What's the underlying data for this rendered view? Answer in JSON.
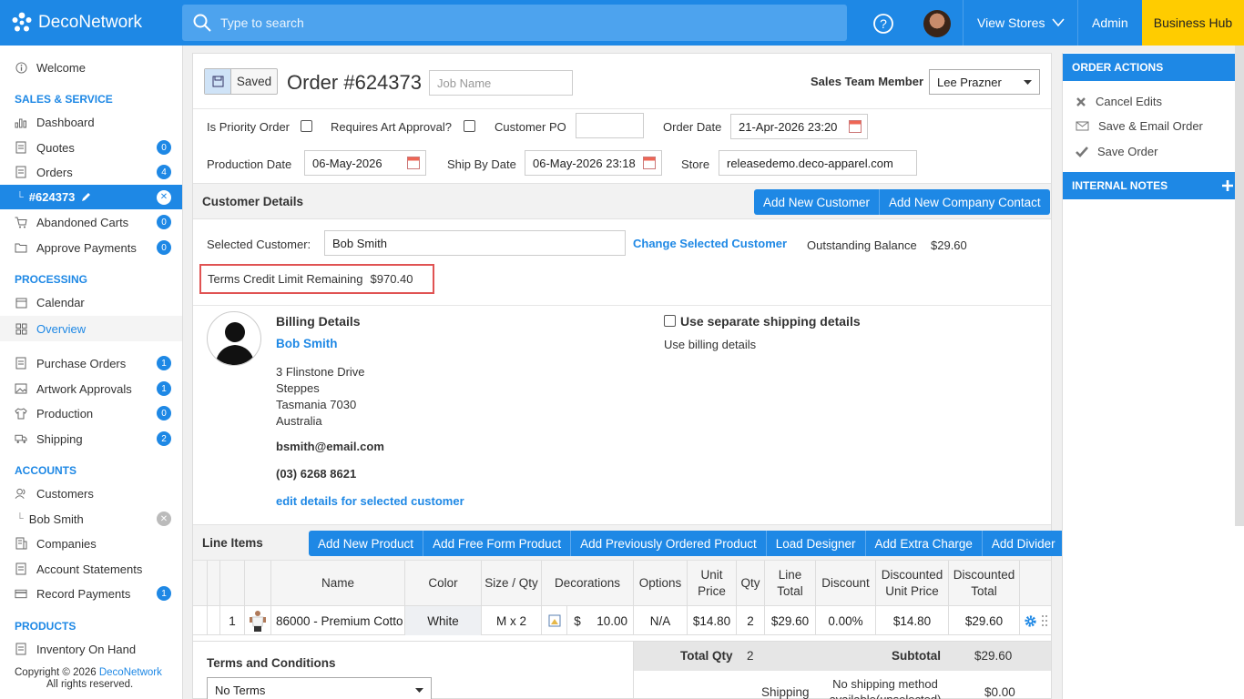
{
  "topbar": {
    "logo": "DecoNetwork",
    "search_placeholder": "Type to search",
    "view_stores": "View Stores",
    "admin": "Admin",
    "business_hub": "Business Hub"
  },
  "sidebar": {
    "welcome": "Welcome",
    "sales_head": "SALES & SERVICE",
    "dashboard": "Dashboard",
    "quotes": "Quotes",
    "quotes_count": "0",
    "orders": "Orders",
    "orders_count": "4",
    "order_sub": "#624373",
    "abandoned": "Abandoned Carts",
    "abandoned_count": "0",
    "approve": "Approve Payments",
    "approve_count": "0",
    "processing_head": "PROCESSING",
    "calendar": "Calendar",
    "overview": "Overview",
    "purchase": "Purchase Orders",
    "purchase_count": "1",
    "artwork": "Artwork Approvals",
    "artwork_count": "1",
    "production": "Production",
    "production_count": "0",
    "shipping": "Shipping",
    "shipping_count": "2",
    "accounts_head": "ACCOUNTS",
    "customers": "Customers",
    "customer_sub": "Bob Smith",
    "companies": "Companies",
    "statements": "Account Statements",
    "record": "Record Payments",
    "record_count": "1",
    "products_head": "PRODUCTS",
    "inventory": "Inventory On Hand",
    "copyright_pre": "Copyright © 2026 ",
    "copyright_link": "DecoNetwork",
    "copyright_post": "All rights reserved."
  },
  "order": {
    "saved": "Saved",
    "title": "Order #624373",
    "job_placeholder": "Job Name",
    "sales_label": "Sales Team Member",
    "sales_value": "Lee Prazner",
    "priority_label": "Is Priority Order",
    "art_label": "Requires Art Approval?",
    "po_label": "Customer PO",
    "order_date_label": "Order Date",
    "order_date": "21-Apr-2026 23:20",
    "prod_date_label": "Production Date",
    "prod_date": "06-May-2026",
    "ship_label": "Ship By Date",
    "ship_date": "06-May-2026 23:18",
    "store_label": "Store",
    "store": "releasedemo.deco-apparel.com"
  },
  "customer": {
    "section": "Customer Details",
    "add_customer": "Add New Customer",
    "add_contact": "Add New Company Contact",
    "selected_label": "Selected Customer:",
    "selected": "Bob Smith",
    "change": "Change Selected Customer",
    "balance_label": "Outstanding Balance",
    "balance": "$29.60",
    "credit_label": "Terms Credit Limit Remaining",
    "credit": "$970.40",
    "billing_head": "Billing Details",
    "name": "Bob Smith",
    "addr1": "3 Flinstone Drive",
    "addr2": "Steppes",
    "addr3": "Tasmania 7030",
    "addr4": "Australia",
    "email": "bsmith@email.com",
    "phone": "(03) 6268 8621",
    "edit": "edit details for selected customer",
    "ship_sep": "Use separate shipping details",
    "ship_use": "Use billing details"
  },
  "lineitems": {
    "section": "Line Items",
    "buttons": [
      "Add New Product",
      "Add Free Form Product",
      "Add Previously Ordered Product",
      "Load Designer",
      "Add Extra Charge",
      "Add Divider"
    ],
    "headers": {
      "name": "Name",
      "color": "Color",
      "size": "Size / Qty",
      "decorations": "Decorations",
      "options": "Options",
      "unit1": "Unit",
      "unit2": "Price",
      "qty": "Qty",
      "line1": "Line",
      "line2": "Total",
      "discount": "Discount",
      "dunit1": "Discounted",
      "dunit2": "Unit Price",
      "dtotal1": "Discounted",
      "dtotal2": "Total"
    },
    "row": {
      "num": "1",
      "name": "86000 - Premium Cotto",
      "color": "White",
      "size": "M x 2",
      "dec_cur": "$",
      "dec_val": "10.00",
      "options": "N/A",
      "unit": "$14.80",
      "qty": "2",
      "line": "$29.60",
      "discount": "0.00%",
      "dunit": "$14.80",
      "dtotal": "$29.60"
    }
  },
  "footer": {
    "terms_head": "Terms and Conditions",
    "terms_value": "No Terms",
    "total_qty_label": "Total Qty",
    "total_qty": "2",
    "subtotal_label": "Subtotal",
    "subtotal": "$29.60",
    "shipping_label": "Shipping",
    "shipping_method1": "No shipping method",
    "shipping_method2": "available(unselected)",
    "shipping_cost": "$0.00"
  },
  "rpanel": {
    "actions_head": "ORDER ACTIONS",
    "cancel": "Cancel Edits",
    "save_email": "Save & Email Order",
    "save": "Save Order",
    "notes_head": "INTERNAL NOTES"
  }
}
